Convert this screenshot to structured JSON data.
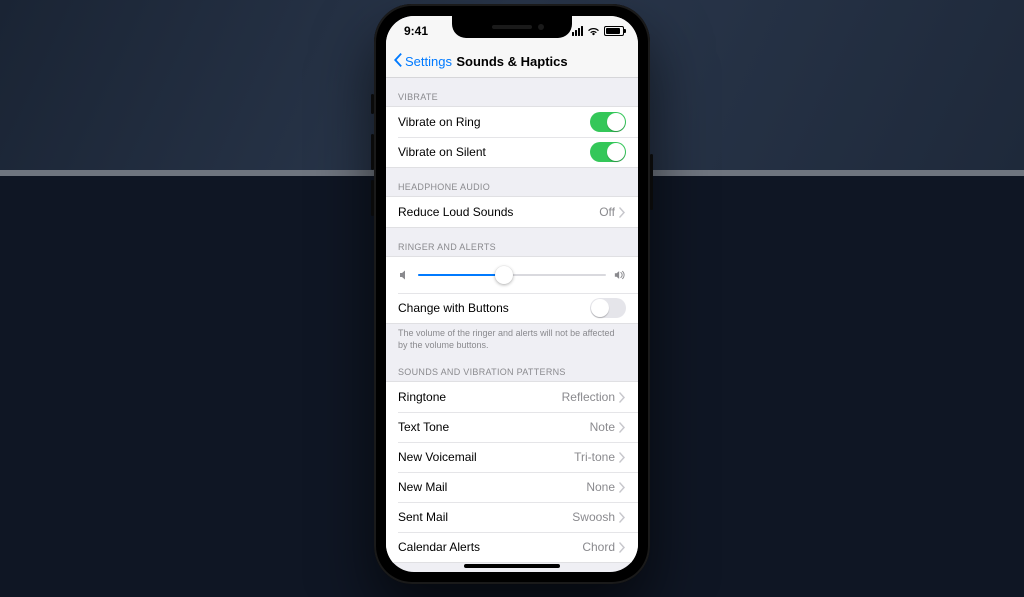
{
  "status": {
    "time": "9:41"
  },
  "nav": {
    "back_label": "Settings",
    "title": "Sounds & Haptics"
  },
  "vibrate": {
    "header": "Vibrate",
    "ring_label": "Vibrate on Ring",
    "ring_on": true,
    "silent_label": "Vibrate on Silent",
    "silent_on": true
  },
  "headphone": {
    "header": "Headphone Audio",
    "reduce_label": "Reduce Loud Sounds",
    "reduce_value": "Off"
  },
  "ringer": {
    "header": "Ringer and Alerts",
    "slider_percent": 46,
    "change_label": "Change with Buttons",
    "change_on": false,
    "footer": "The volume of the ringer and alerts will not be affected by the volume buttons."
  },
  "patterns": {
    "header": "Sounds and Vibration Patterns",
    "items": [
      {
        "label": "Ringtone",
        "value": "Reflection"
      },
      {
        "label": "Text Tone",
        "value": "Note"
      },
      {
        "label": "New Voicemail",
        "value": "Tri-tone"
      },
      {
        "label": "New Mail",
        "value": "None"
      },
      {
        "label": "Sent Mail",
        "value": "Swoosh"
      },
      {
        "label": "Calendar Alerts",
        "value": "Chord"
      }
    ]
  }
}
